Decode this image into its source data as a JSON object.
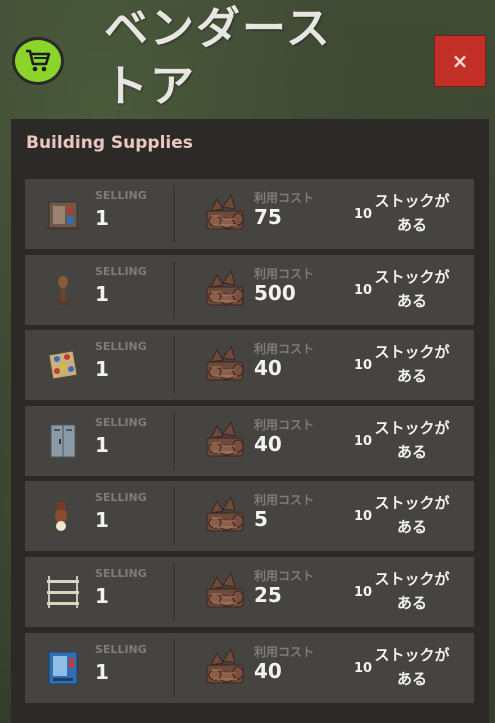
{
  "header": {
    "title": "ベンダーストア",
    "close_label": "×"
  },
  "panel": {
    "category": "Building Supplies",
    "items": [
      {
        "icon": "electrical-box-icon",
        "selling_label": "SELLING",
        "qty": "1",
        "cost_label": "利用コスト",
        "cost": "75",
        "stock_count": "10",
        "stock_label": "ストックがある"
      },
      {
        "icon": "wall-torch-icon",
        "selling_label": "SELLING",
        "qty": "1",
        "cost_label": "利用コスト",
        "cost": "500",
        "stock_count": "10",
        "stock_label": "ストックがある"
      },
      {
        "icon": "pattern-mosaic-icon",
        "selling_label": "SELLING",
        "qty": "1",
        "cost_label": "利用コスト",
        "cost": "40",
        "stock_count": "10",
        "stock_label": "ストックがある"
      },
      {
        "icon": "locker-icon",
        "selling_label": "SELLING",
        "qty": "1",
        "cost_label": "利用コスト",
        "cost": "40",
        "stock_count": "10",
        "stock_label": "ストックがある"
      },
      {
        "icon": "wall-lamp-icon",
        "selling_label": "SELLING",
        "qty": "1",
        "cost_label": "利用コスト",
        "cost": "5",
        "stock_count": "10",
        "stock_label": "ストックがある"
      },
      {
        "icon": "shelves-icon",
        "selling_label": "SELLING",
        "qty": "1",
        "cost_label": "利用コスト",
        "cost": "25",
        "stock_count": "10",
        "stock_label": "ストックがある"
      },
      {
        "icon": "vending-machine-icon",
        "selling_label": "SELLING",
        "qty": "1",
        "cost_label": "利用コスト",
        "cost": "40",
        "stock_count": "10",
        "stock_label": "ストックがある"
      }
    ]
  },
  "colors": {
    "cart_button": "#8bd42a",
    "close_button": "#c12f27",
    "panel_bg": "#2b2a27",
    "row_bg": "#454441",
    "category_text": "#e9c7c2"
  }
}
